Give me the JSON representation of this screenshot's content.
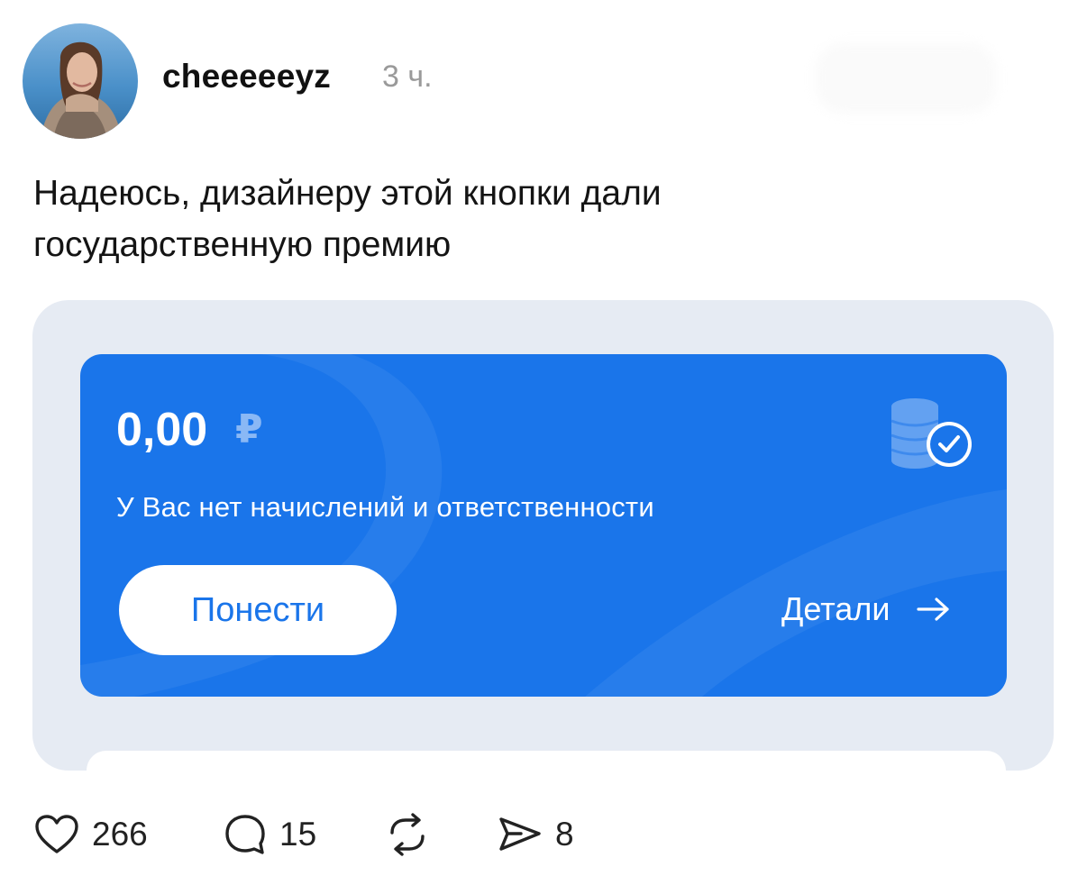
{
  "post": {
    "username": "cheeeeeyz",
    "time_ago": "3 ч.",
    "text": "Надеюсь, дизайнеру этой кнопки дали\nгосударственную премию"
  },
  "card": {
    "amount": "0,00",
    "currency_symbol": "₽",
    "subtitle": "У Вас нет начислений и ответственности",
    "pay_button_label": "Понести",
    "details_label": "Детали",
    "accent_color": "#1a75ea"
  },
  "actions": {
    "likes": "266",
    "comments": "15",
    "shares": "8"
  },
  "icons": [
    "avatar",
    "coins-check-icon",
    "arrow-right-icon",
    "heart-icon",
    "comment-icon",
    "repost-icon",
    "send-icon"
  ]
}
